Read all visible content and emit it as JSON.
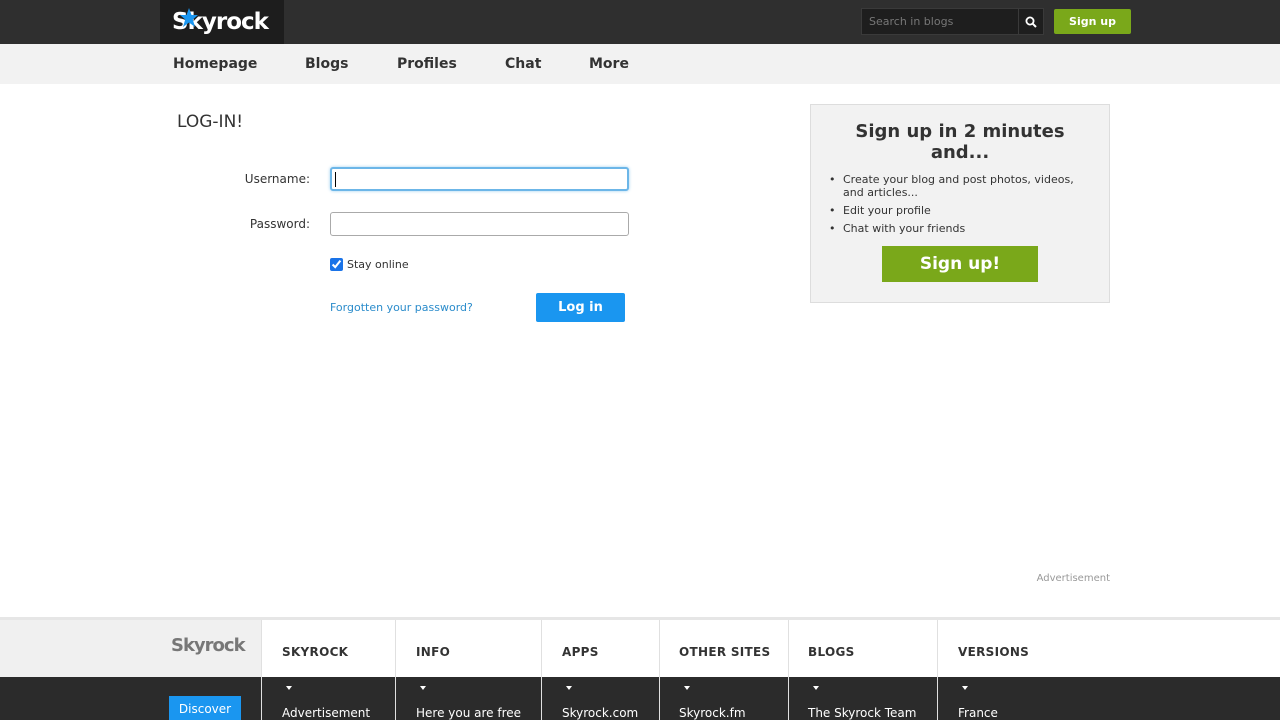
{
  "header": {
    "logo_text": "Skyrock",
    "search_placeholder": "Search in blogs",
    "signup_label": "Sign up"
  },
  "nav": {
    "items": [
      {
        "label": "Homepage"
      },
      {
        "label": "Blogs"
      },
      {
        "label": "Profiles"
      },
      {
        "label": "Chat"
      },
      {
        "label": "More"
      }
    ]
  },
  "login": {
    "title": "LOG-IN!",
    "username_label": "Username:",
    "username_value": "",
    "password_label": "Password:",
    "password_value": "",
    "stay_online_label": "Stay online",
    "stay_online_checked": true,
    "forgot_label": "Forgotten your password?",
    "login_button": "Log in"
  },
  "signup_panel": {
    "title": "Sign up in 2 minutes and...",
    "features": [
      "Create your blog and post photos, videos, and articles...",
      "Edit your profile",
      "Chat with your friends"
    ],
    "button": "Sign up!"
  },
  "advertisement_label": "Advertisement",
  "footer": {
    "logo_text": "Skyrock",
    "discover_label": "Discover",
    "columns": [
      {
        "heading": "SKYROCK",
        "link": "Advertisement"
      },
      {
        "heading": "INFO",
        "link": "Here you are free"
      },
      {
        "heading": "APPS",
        "link": "Skyrock.com"
      },
      {
        "heading": "OTHER SITES",
        "link": "Skyrock.fm"
      },
      {
        "heading": "BLOGS",
        "link": "The Skyrock Team"
      },
      {
        "heading": "VERSIONS",
        "link": "France"
      }
    ]
  },
  "colors": {
    "topbar": "#2f2f2f",
    "accent_green": "#7aa81a",
    "accent_blue": "#1a96f0",
    "link_blue": "#2b8ccb"
  }
}
